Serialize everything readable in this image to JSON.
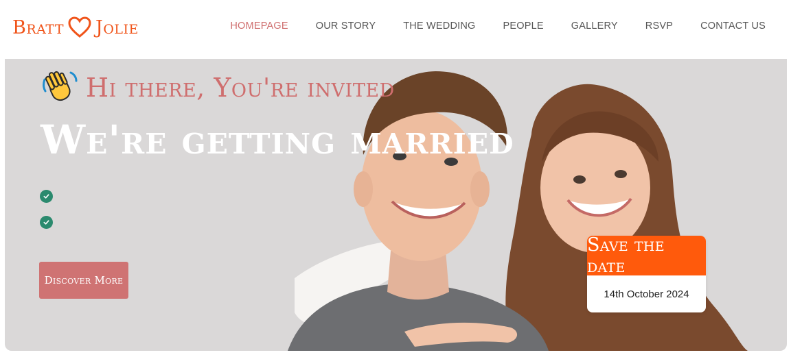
{
  "brand": {
    "name_left": "Bratt",
    "name_right": "Jolie",
    "heart_icon": "heart-icon",
    "color": "#f0541a"
  },
  "nav": {
    "items": [
      {
        "label": "HOMEPAGE",
        "active": true
      },
      {
        "label": "OUR STORY"
      },
      {
        "label": "THE WEDDING"
      },
      {
        "label": "PEOPLE"
      },
      {
        "label": "GALLERY"
      },
      {
        "label": "RSVP"
      },
      {
        "label": "CONTACT US"
      }
    ],
    "active_color": "#cf6e6e"
  },
  "hero": {
    "greeting_icon": "waving-hand-icon",
    "greeting": "Hi there, You're invited",
    "headline": "We're getting married",
    "check_icon": "check-circle-icon",
    "discover_label": "Discover More",
    "photo": "smiling-couple-photo"
  },
  "save_the_date": {
    "title": "Save the date",
    "date": "14th October 2024",
    "accent": "#ff5a0c"
  }
}
